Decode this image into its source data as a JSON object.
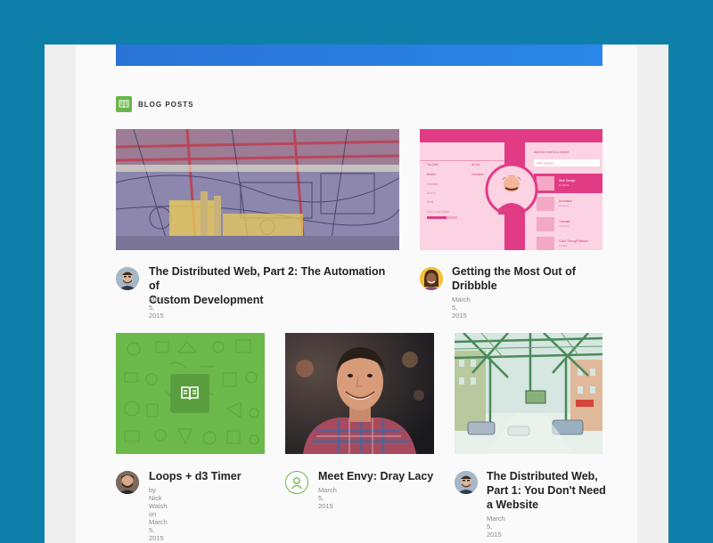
{
  "section": {
    "label": "BLOG POSTS",
    "icon": "book-icon"
  },
  "colors": {
    "background": "#0d7fa8",
    "accent_green": "#6ab64a",
    "hero_blue": "#2a7de0",
    "dribbble_pink": "#e23b85"
  },
  "posts": [
    {
      "title_line1": "The Distributed Web, Part 2: The Automation of",
      "title_line2": "Custom Development",
      "date": "March 5, 2015"
    },
    {
      "title_line1": "Getting the Most Out of",
      "title_line2": "Dribbble",
      "date": "March 5, 2015"
    },
    {
      "title": "Loops + d3 Timer",
      "byline": "by Nick Walsh on March 5, 2015"
    },
    {
      "title": "Meet Envy: Dray Lacy",
      "date": "March 5, 2015"
    },
    {
      "title_line1": "The Distributed Web,",
      "title_line2": "Part 1: You Don't Need",
      "title_line3": "a Website",
      "date": "March 5, 2015"
    }
  ],
  "mock_ui": {
    "header": "Add this shot to a bucket",
    "left_items": [
      "You (Me)",
      "Bucket",
      "Selected",
      "All of it",
      "Work",
      "Add a new bucket"
    ],
    "left_right_items": [
      "All You",
      "4 buckets"
    ],
    "right_items": [
      {
        "name": "Web Design",
        "sub": "17 shots"
      },
      {
        "name": "Animation",
        "sub": "10 shots"
      },
      {
        "name": "Tutorials",
        "sub": "23 shots"
      },
      {
        "name": "Color Theory/Palettes",
        "sub": "3 shots"
      }
    ],
    "right_placeholder": "Filter buckets"
  }
}
